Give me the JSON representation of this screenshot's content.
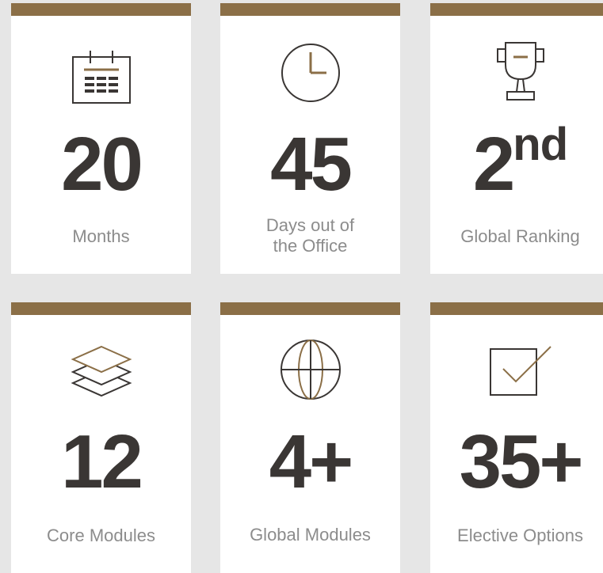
{
  "colors": {
    "background": "#e6e6e6",
    "card": "#ffffff",
    "accent": "#8b6f47",
    "value_text": "#3a3634",
    "label_text": "#8c8c8c"
  },
  "stats": [
    {
      "icon": "calendar-icon",
      "value": "20",
      "suffix": "",
      "label": "Months"
    },
    {
      "icon": "clock-icon",
      "value": "45",
      "suffix": "",
      "label": "Days out of\nthe Office"
    },
    {
      "icon": "trophy-icon",
      "value": "2",
      "suffix": "nd",
      "label": "Global Ranking"
    },
    {
      "icon": "layers-icon",
      "value": "12",
      "suffix": "",
      "label": "Core Modules"
    },
    {
      "icon": "globe-icon",
      "value": "4+",
      "suffix": "",
      "label": "Global Modules"
    },
    {
      "icon": "checkbox-icon",
      "value": "35+",
      "suffix": "",
      "label": "Elective Options"
    }
  ]
}
